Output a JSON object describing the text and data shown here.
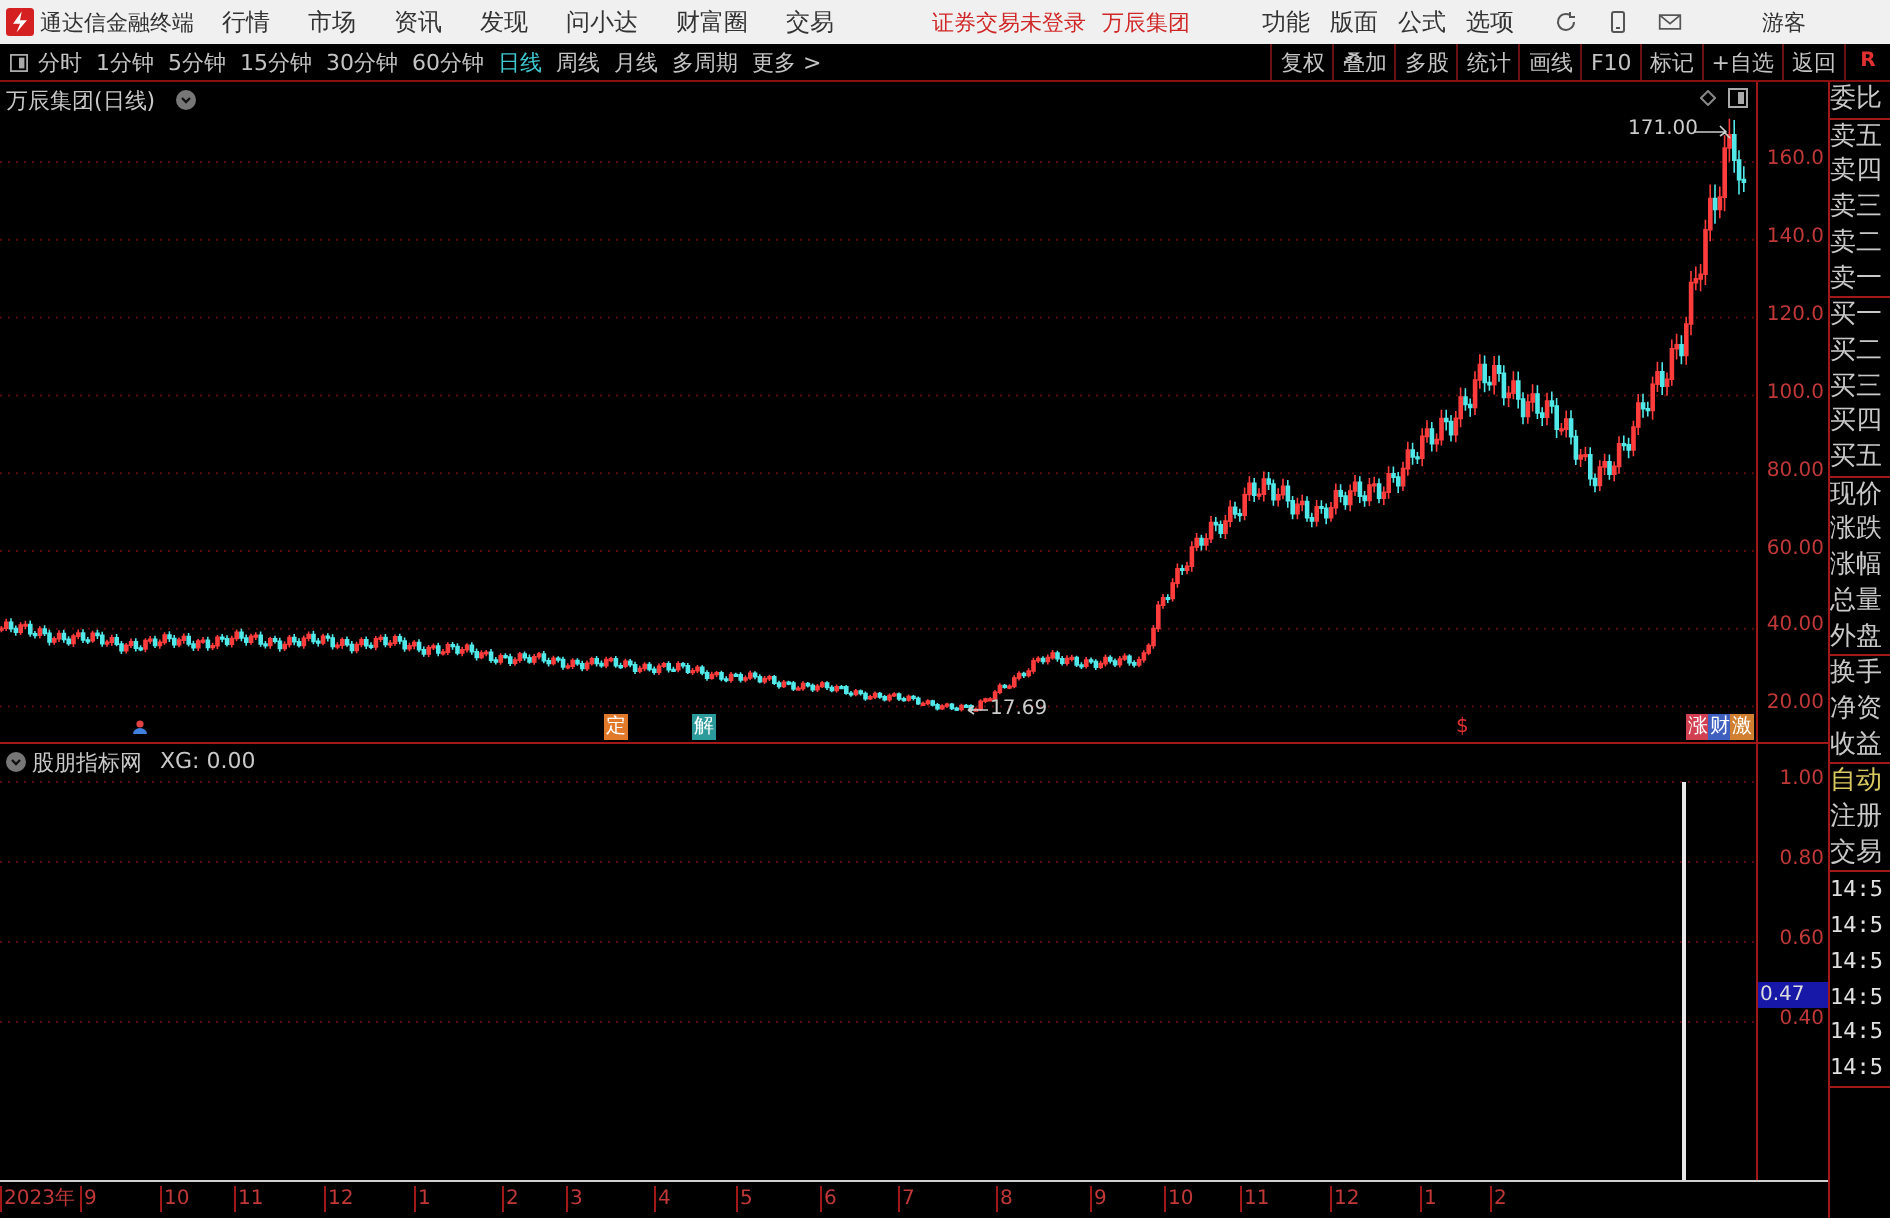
{
  "app": {
    "title": "通达信金融终端"
  },
  "menu": [
    "行情",
    "市场",
    "资讯",
    "发现",
    "问小达",
    "财富圈",
    "交易"
  ],
  "login_notice": "证券交易未登录",
  "stock_name": "万辰集团",
  "right_menu": [
    "功能",
    "版面",
    "公式",
    "选项"
  ],
  "user": "游客",
  "periods": [
    {
      "label": "分时",
      "selected": false
    },
    {
      "label": "1分钟",
      "selected": false
    },
    {
      "label": "5分钟",
      "selected": false
    },
    {
      "label": "15分钟",
      "selected": false
    },
    {
      "label": "30分钟",
      "selected": false
    },
    {
      "label": "60分钟",
      "selected": false
    },
    {
      "label": "日线",
      "selected": true
    },
    {
      "label": "周线",
      "selected": false
    },
    {
      "label": "月线",
      "selected": false
    },
    {
      "label": "多周期",
      "selected": false
    },
    {
      "label": "更多 >",
      "selected": false
    }
  ],
  "tools": [
    "复权",
    "叠加",
    "多股",
    "统计",
    "画线",
    "F10",
    "标记",
    "+自选",
    "返回"
  ],
  "corner": "R",
  "main_chart": {
    "title": "万辰集团(日线)",
    "high_label": "171.00",
    "low_label": "17.69",
    "yticks": [
      "160.0",
      "140.0",
      "120.0",
      "100.0",
      "80.00",
      "60.00",
      "40.00",
      "20.00"
    ],
    "markers": [
      {
        "text": "定",
        "color": "#e07a2a"
      },
      {
        "text": "解",
        "color": "#2a9a9a"
      },
      {
        "text": "$",
        "color": "#e03030"
      },
      {
        "text": "涨",
        "color": "#d04050"
      },
      {
        "text": "财",
        "color": "#4060c0"
      },
      {
        "text": "激",
        "color": "#d08030"
      }
    ]
  },
  "indicator": {
    "title": "股朋指标网",
    "reading": "XG: 0.00",
    "yticks": [
      "1.00",
      "0.80",
      "0.60",
      "0.40"
    ],
    "current": "0.47"
  },
  "xaxis": [
    "2023年",
    "9",
    "10",
    "11",
    "12",
    "1",
    "2",
    "3",
    "4",
    "5",
    "6",
    "7",
    "8",
    "9",
    "10",
    "11",
    "12",
    "1",
    "2"
  ],
  "side_panel": [
    {
      "items": [
        {
          "label": "委比",
          "kind": "plain"
        }
      ]
    },
    {
      "items": [
        {
          "label": "卖五",
          "kind": "plain"
        },
        {
          "label": "卖四",
          "kind": "plain"
        },
        {
          "label": "卖三",
          "kind": "plain"
        },
        {
          "label": "卖二",
          "kind": "plain"
        },
        {
          "label": "卖一",
          "kind": "plain"
        }
      ]
    },
    {
      "items": [
        {
          "label": "买一",
          "kind": "plain"
        },
        {
          "label": "买二",
          "kind": "plain"
        },
        {
          "label": "买三",
          "kind": "plain"
        },
        {
          "label": "买四",
          "kind": "plain"
        },
        {
          "label": "买五",
          "kind": "plain"
        }
      ]
    },
    {
      "items": [
        {
          "label": "现价",
          "kind": "plain"
        },
        {
          "label": "涨跌",
          "kind": "plain"
        },
        {
          "label": "涨幅",
          "kind": "plain"
        },
        {
          "label": "总量",
          "kind": "plain"
        },
        {
          "label": "外盘",
          "kind": "plain"
        }
      ]
    },
    {
      "items": [
        {
          "label": "换手",
          "kind": "plain"
        },
        {
          "label": "净资",
          "kind": "plain"
        },
        {
          "label": "收益",
          "kind": "plain"
        }
      ]
    },
    {
      "items": [
        {
          "label": "自动",
          "kind": "accent"
        },
        {
          "label": "注册",
          "kind": "plain"
        },
        {
          "label": "交易",
          "kind": "plain"
        }
      ]
    },
    {
      "items": [
        {
          "label": "14:5",
          "kind": "time"
        },
        {
          "label": "14:5",
          "kind": "time"
        },
        {
          "label": "14:5",
          "kind": "time"
        },
        {
          "label": "14:5",
          "kind": "time"
        },
        {
          "label": "14:5",
          "kind": "time"
        },
        {
          "label": "14:5",
          "kind": "time"
        }
      ]
    }
  ]
}
